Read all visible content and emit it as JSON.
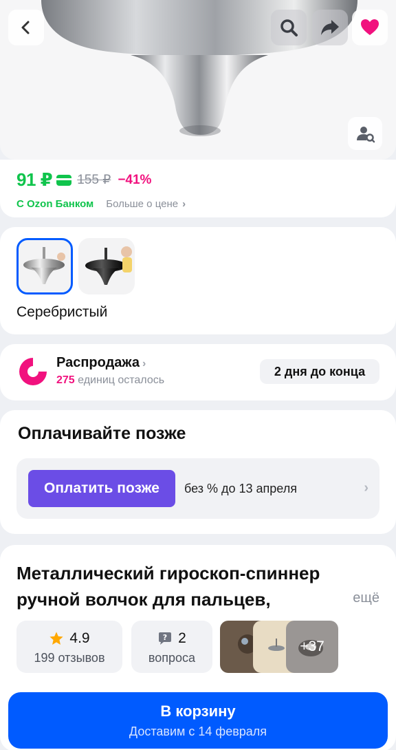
{
  "header": {
    "back_icon": "chevron-left-icon",
    "search_icon": "search-icon",
    "share_icon": "share-arrow-icon",
    "favorite_icon": "heart-icon",
    "lens_icon": "image-search-icon"
  },
  "price": {
    "current": "91 ₽",
    "old": "155 ₽",
    "discount": "−41%",
    "bank_label": "С Ozon Банком",
    "more_label": "Больше о цене",
    "accent_color": "#10c44c",
    "discount_color": "#f1117e"
  },
  "variants": {
    "selected_label": "Серебристый",
    "options": [
      "silver",
      "black"
    ]
  },
  "sale": {
    "title": "Распродажа",
    "count": "275",
    "count_suffix": "единиц осталось",
    "deadline": "2 дня до конца"
  },
  "pay_later": {
    "title": "Оплачивайте позже",
    "button": "Оплатить позже",
    "terms": "без % до 13 апреля",
    "button_color": "#6b4de6"
  },
  "product": {
    "title": "Металлический гироскоп-спиннер ручной волчок для пальцев,",
    "more": "ещё",
    "rating": "4.9",
    "reviews": "199 отзывов",
    "questions_count": "2",
    "questions_label": "вопроса",
    "photos_more": "+37"
  },
  "cart": {
    "label": "В корзину",
    "delivery": "Доставим с 14 февраля",
    "color": "#005bff"
  }
}
